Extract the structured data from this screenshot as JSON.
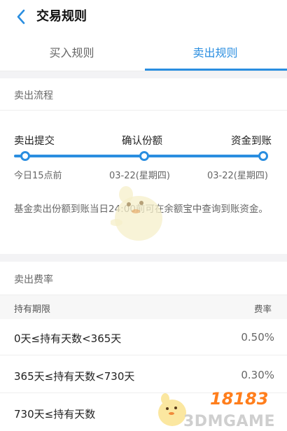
{
  "header": {
    "title": "交易规则",
    "back_icon": "chevron-left-icon"
  },
  "tabs": [
    {
      "label": "买入规则",
      "active": false
    },
    {
      "label": "卖出规则",
      "active": true
    }
  ],
  "accent_color": "#2a8ee0",
  "flow_section": {
    "title": "卖出流程",
    "steps": [
      {
        "label": "卖出提交",
        "date": "今日15点前"
      },
      {
        "label": "确认份额",
        "date": "03-22(星期四)"
      },
      {
        "label": "资金到账",
        "date": "03-22(星期四)"
      }
    ],
    "description": "基金卖出份额到账当日24:00前可在余额宝中查询到账资金。"
  },
  "fee_section": {
    "title": "卖出费率",
    "columns": [
      "持有期限",
      "费率"
    ],
    "rows": [
      {
        "period": "0天≤持有天数<365天",
        "rate": "0.50%"
      },
      {
        "period": "365天≤持有天数<730天",
        "rate": "0.30%"
      },
      {
        "period": "730天≤持有天数",
        "rate": ""
      }
    ]
  },
  "watermark": {
    "logo": "18183",
    "text": "3DMGAME"
  }
}
